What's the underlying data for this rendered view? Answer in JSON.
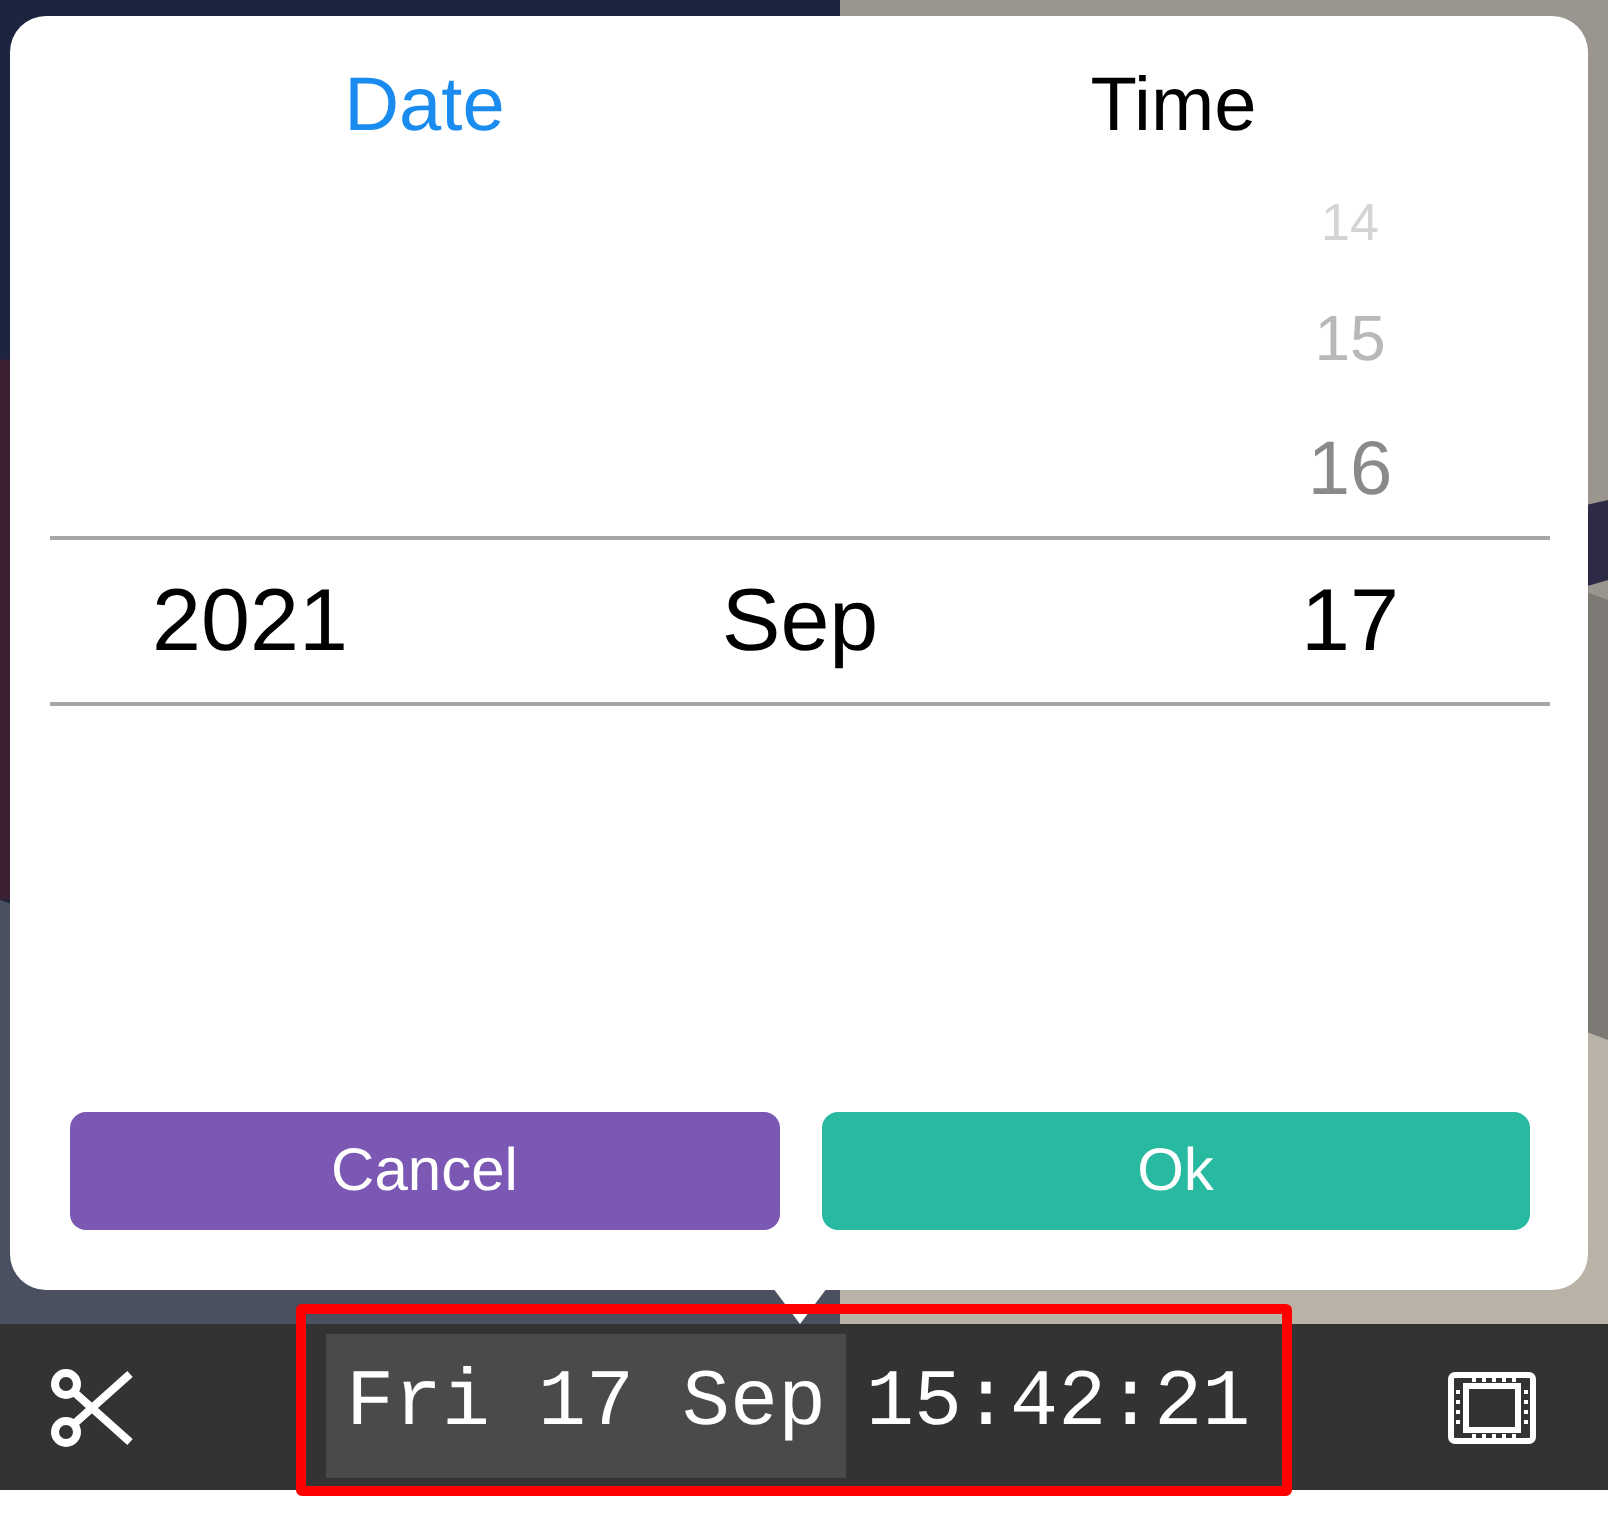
{
  "picker": {
    "tabs": [
      {
        "label": "Date",
        "selected": true
      },
      {
        "label": "Time",
        "selected": false
      }
    ],
    "columns": [
      {
        "selected": "2021"
      },
      {
        "selected": "Sep"
      },
      {
        "above": [
          "14",
          "15",
          "16"
        ],
        "selected": "17"
      }
    ],
    "buttons": [
      {
        "label": "Cancel",
        "kind": "cancel"
      },
      {
        "label": "Ok",
        "kind": "ok"
      }
    ]
  },
  "toolbar": {
    "date": "Fri 17 Sep",
    "time": "15:42:21",
    "highlighted": true
  }
}
